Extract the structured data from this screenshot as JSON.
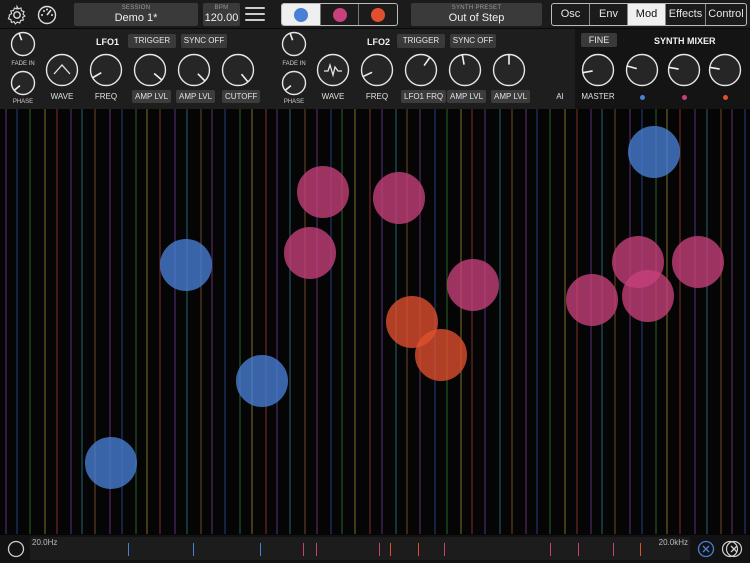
{
  "topbar": {
    "session_caption": "SESSION",
    "session_name": "Demo 1*",
    "bpm_caption": "BPM",
    "bpm_value": "120.00",
    "preset_caption": "SYNTH PRESET",
    "preset_name": "Out of Step",
    "synth_colors": [
      "#4a7fd6",
      "#c8407c",
      "#e0502e"
    ],
    "tabs": [
      "Osc",
      "Env",
      "Mod",
      "Effects",
      "Control"
    ],
    "active_tab": "Mod"
  },
  "lfo1": {
    "title": "LFO1",
    "trigger": "TRIGGER",
    "sync": "SYNC OFF",
    "fade_in": "FADE IN",
    "phase": "PHASE",
    "wave": "WAVE",
    "freq": "FREQ",
    "amp_lvl_1": "AMP LVL",
    "amp_lvl_2": "AMP LVL",
    "cutoff": "CUTOFF"
  },
  "lfo2": {
    "title": "LFO2",
    "trigger": "TRIGGER",
    "sync": "SYNC OFF",
    "fade_in": "FADE IN",
    "phase": "PHASE",
    "wave": "WAVE",
    "freq": "FREQ",
    "lfo1_frq": "LFO1 FRQ",
    "amp_lvl_1": "AMP LVL",
    "amp_lvl_2": "AMP LVL",
    "cut_label": "AI"
  },
  "mixer": {
    "fine": "FINE",
    "title": "SYNTH MIXER",
    "master": "MASTER"
  },
  "bottom": {
    "freq_min": "20.0Hz",
    "freq_max": "20.0kHz"
  }
}
